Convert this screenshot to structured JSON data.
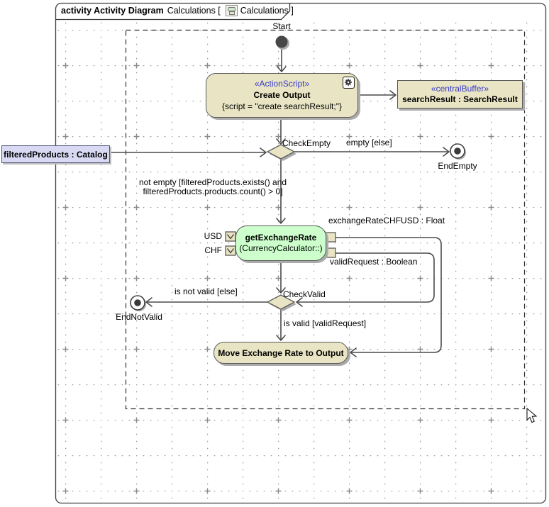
{
  "frame": {
    "title_bold": "activity Activity Diagram",
    "title_mid": "Calculations [",
    "title_end": "Calculations ]",
    "diagram_icon": "activity-diagram-icon"
  },
  "colors": {
    "node_fill": "#e9e5c4",
    "node_border": "#5a5a5a",
    "action_green_fill": "#ccffcc",
    "parameter_fill": "#d9d9f3",
    "stereotype_text": "#3a3ac8",
    "edge": "#4a4a4a",
    "shadow": "#ababab",
    "grid_dot": "#9c9c9c"
  },
  "nodes": {
    "start": {
      "label": "Start"
    },
    "create_output": {
      "stereotype": "«ActionScript»",
      "name": "Create Output",
      "script": "{script = \"create searchResult;\"}",
      "icon": "behavior-gear-icon"
    },
    "search_result_buffer": {
      "stereotype": "«centralBuffer»",
      "name": "searchResult : SearchResult"
    },
    "filtered_products": {
      "name": "filteredProducts : Catalog"
    },
    "check_empty": {
      "label": "CheckEmpty"
    },
    "end_empty": {
      "label": "EndEmpty"
    },
    "get_exchange_rate": {
      "name": "getExchangeRate",
      "qualifier": "(CurrencyCalculator::)",
      "pins": {
        "usd": "USD",
        "chf": "CHF",
        "rate": "exchangeRateCHFUSD : Float",
        "valid": "validRequest : Boolean"
      }
    },
    "check_valid": {
      "label": "CheckValid"
    },
    "end_not_valid": {
      "label": "EndNotValid"
    },
    "move_output": {
      "name": "Move Exchange Rate to Output"
    }
  },
  "edges": {
    "empty_guard": "empty [else]",
    "not_empty_guard_line1": "not empty [filteredProducts.exists() and",
    "not_empty_guard_line2": "filteredProducts.products.count() > 0]",
    "not_valid_guard": "is not valid [else]",
    "valid_guard": "is valid [validRequest]"
  }
}
